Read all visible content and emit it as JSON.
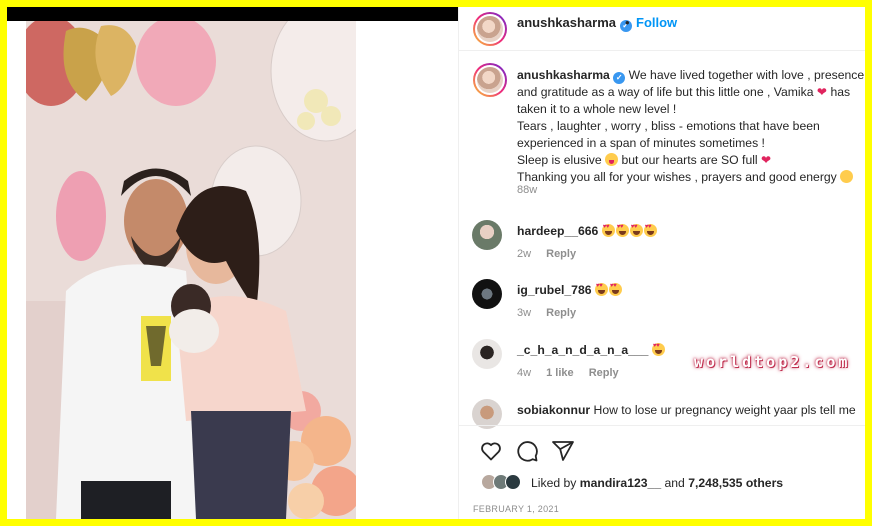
{
  "post": {
    "username": "anushkasharma",
    "verified": true,
    "separator": "•",
    "follow_label": "Follow",
    "caption_lines": [
      "We have lived together with love , presence",
      "and gratitude as a way of life but this little one , Vamika",
      "has",
      "taken it to a whole new level !",
      "Tears , laughter , worry , bliss - emotions that have been",
      "experienced in a span of minutes sometimes !",
      "Sleep is elusive",
      "but our hearts are SO full",
      "Thanking you all for your wishes , prayers and good energy"
    ],
    "caption_time": "88w",
    "date": "FEBRUARY 1, 2021"
  },
  "comments": [
    {
      "user": "hardeep__666",
      "text": "",
      "emoji_count": 4,
      "time": "2w",
      "likes": "",
      "reply": "Reply"
    },
    {
      "user": "ig_rubel_786",
      "text": "",
      "emoji_count": 2,
      "time": "3w",
      "likes": "",
      "reply": "Reply"
    },
    {
      "user": "_c_h_a_n_d_a_n_a___",
      "text": "",
      "emoji_count": 1,
      "time": "4w",
      "likes": "1 like",
      "reply": "Reply"
    },
    {
      "user": "sobiakonnur",
      "text": "How to lose ur pregnancy weight yaar pls tell me",
      "emoji_count": 0,
      "time": "",
      "likes": "",
      "reply": ""
    }
  ],
  "likes": {
    "prefix": "Liked by",
    "user": "mandira123__",
    "middle": "and",
    "count": "7,248,535 others"
  },
  "watermark": "worldtop2.com",
  "icons": {
    "heart": "heart-icon",
    "comment": "comment-icon",
    "share": "share-icon"
  },
  "colors": {
    "frame": "#ffff00",
    "accent": "#0095f6",
    "verified": "#3897f0",
    "heart": "#e0245e"
  }
}
